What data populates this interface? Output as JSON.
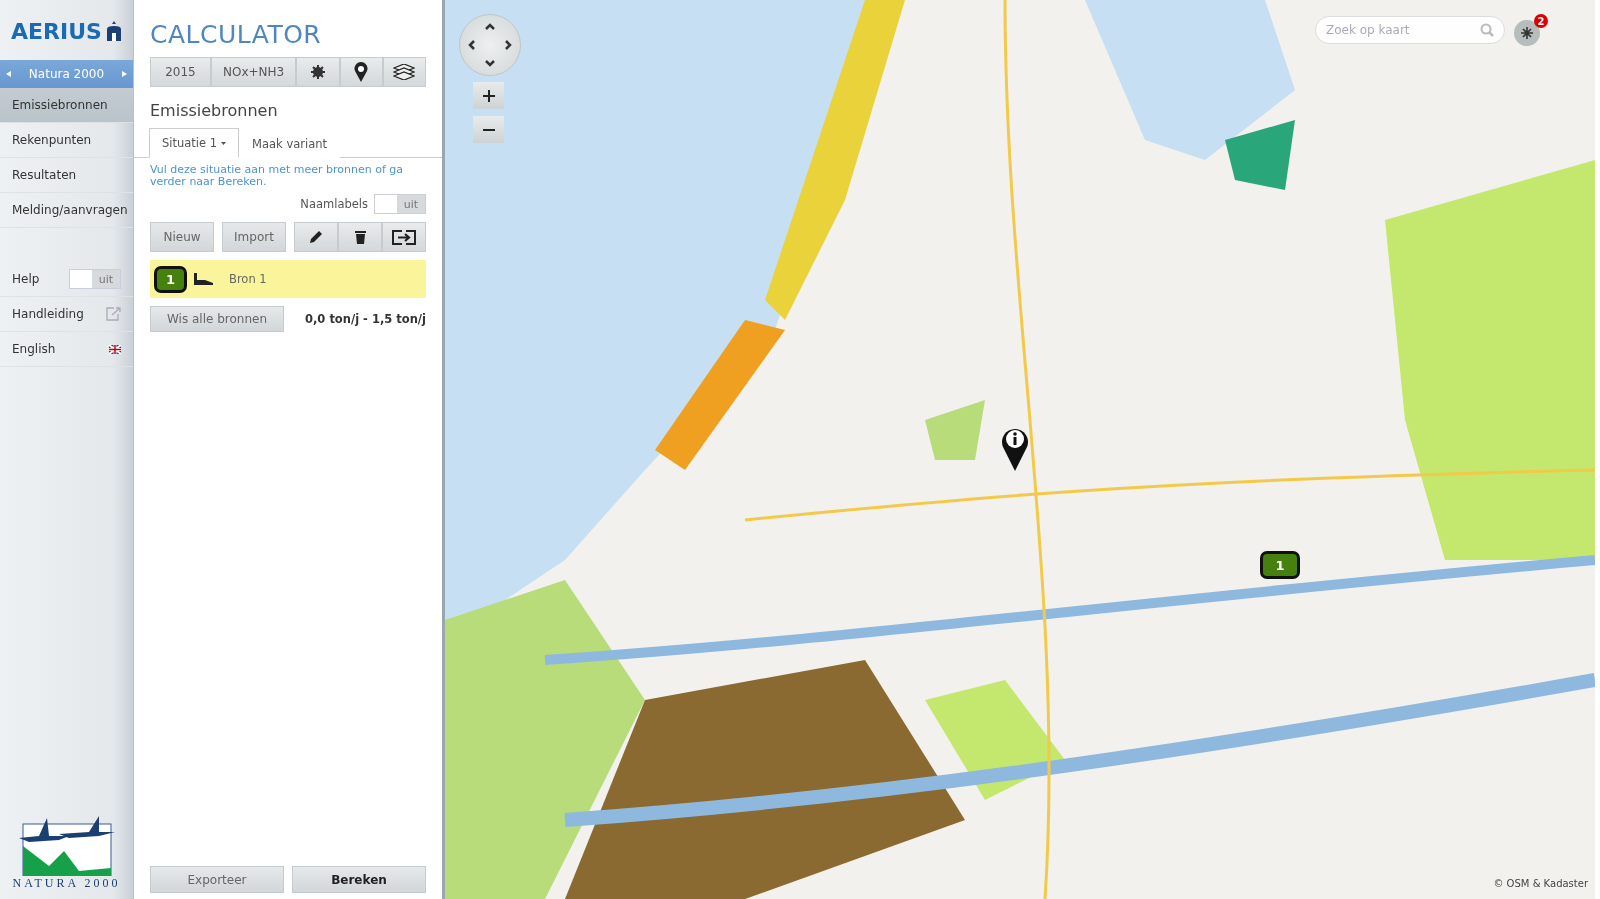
{
  "app": {
    "logo": "AERIUS",
    "product": "CALCULATOR"
  },
  "context_switch": {
    "label": "Natura 2000"
  },
  "nav": [
    {
      "label": "Emissiebronnen",
      "selected": true
    },
    {
      "label": "Rekenpunten",
      "selected": false
    },
    {
      "label": "Resultaten",
      "selected": false
    },
    {
      "label": "Melding/aanvragen",
      "selected": false
    }
  ],
  "help": {
    "label": "Help",
    "on": false,
    "state": "uit"
  },
  "links": [
    {
      "label": "Handleiding",
      "kind": "external"
    },
    {
      "label": "English",
      "kind": "language"
    }
  ],
  "natura_logo": {
    "caption": "NATURA 2000"
  },
  "toolbar": {
    "year": "2015",
    "substance": "NOx+NH3"
  },
  "section_title": "Emissiebronnen",
  "tabs": [
    {
      "label": "Situatie 1",
      "selected": true,
      "dropdown": true
    },
    {
      "label": "Maak variant",
      "selected": false,
      "dropdown": false
    }
  ],
  "hint": "Vul deze situatie aan met meer bronnen of ga verder naar Bereken.",
  "name_labels": {
    "label": "Naamlabels",
    "on": false,
    "state": "uit"
  },
  "actions": [
    "Nieuw",
    "Import"
  ],
  "sources": [
    {
      "number": "1",
      "name": "Bron 1",
      "selected": true
    }
  ],
  "clear_button": "Wis alle bronnen",
  "totals": "0,0 ton/j - 1,5 ton/j",
  "footer_buttons": [
    {
      "label": "Exporteer",
      "primary": false
    },
    {
      "label": "Bereken",
      "primary": true
    }
  ],
  "map": {
    "kind": "picture",
    "search_placeholder": "Zoek op kaart",
    "notification_count": "2",
    "markers": [
      {
        "kind": "info"
      },
      {
        "kind": "source",
        "label": "1"
      }
    ],
    "attribution": "© OSM & Kadaster"
  }
}
